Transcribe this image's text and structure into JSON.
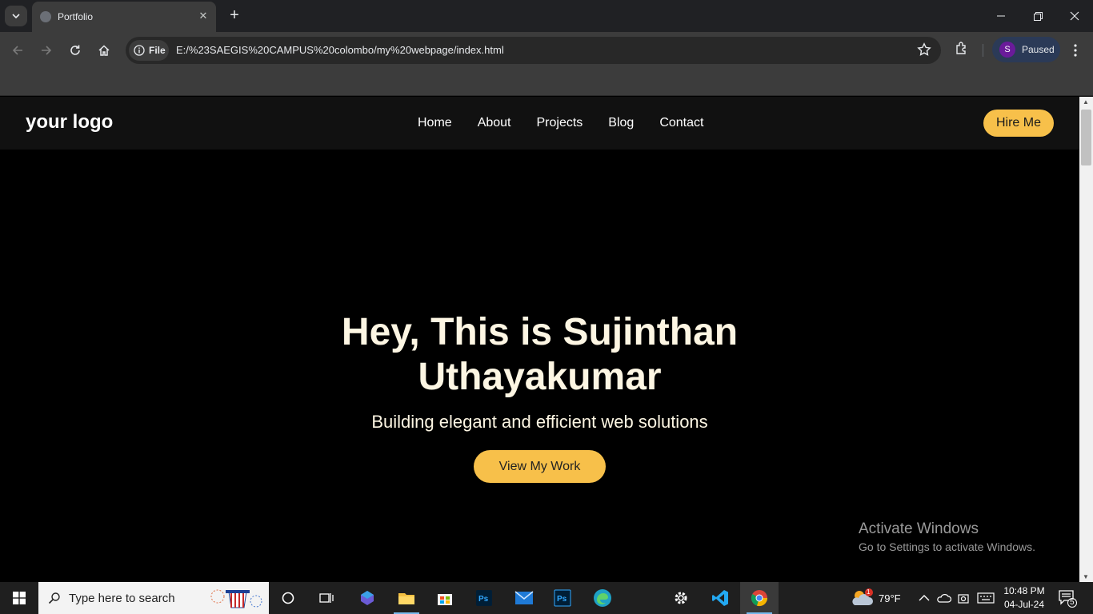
{
  "browser": {
    "tab_title": "Portfolio",
    "file_chip": "File",
    "url": "E:/%23SAEGIS%20CAMPUS%20colombo/my%20webpage/index.html",
    "profile_initial": "S",
    "profile_status": "Paused"
  },
  "site": {
    "logo": "your logo",
    "nav": [
      "Home",
      "About",
      "Projects",
      "Blog",
      "Contact"
    ],
    "hire_label": "Hire Me",
    "hero_title_line1": "Hey, This is Sujinthan",
    "hero_title_line2": "Uthayakumar",
    "hero_subtitle": "Building elegant and efficient web solutions",
    "cta_label": "View My Work"
  },
  "watermark": {
    "title": "Activate Windows",
    "subtitle": "Go to Settings to activate Windows."
  },
  "taskbar": {
    "search_placeholder": "Type here to search",
    "weather_temp": "79°F",
    "weather_badge": "1",
    "time": "10:48 PM",
    "date": "04-Jul-24",
    "notification_count": "5",
    "apps": [
      "cortana-icon",
      "task-view-icon",
      "copilot-icon",
      "file-explorer-icon",
      "store-icon",
      "photoshop-icon",
      "mail-icon",
      "photoshop-icon",
      "edge-icon",
      "settings-icon",
      "vscode-icon",
      "chrome-icon"
    ]
  },
  "colors": {
    "accent": "#f7c04a",
    "hero_text": "#fdf6e3",
    "header_bg": "#111111",
    "page_bg": "#000000"
  }
}
